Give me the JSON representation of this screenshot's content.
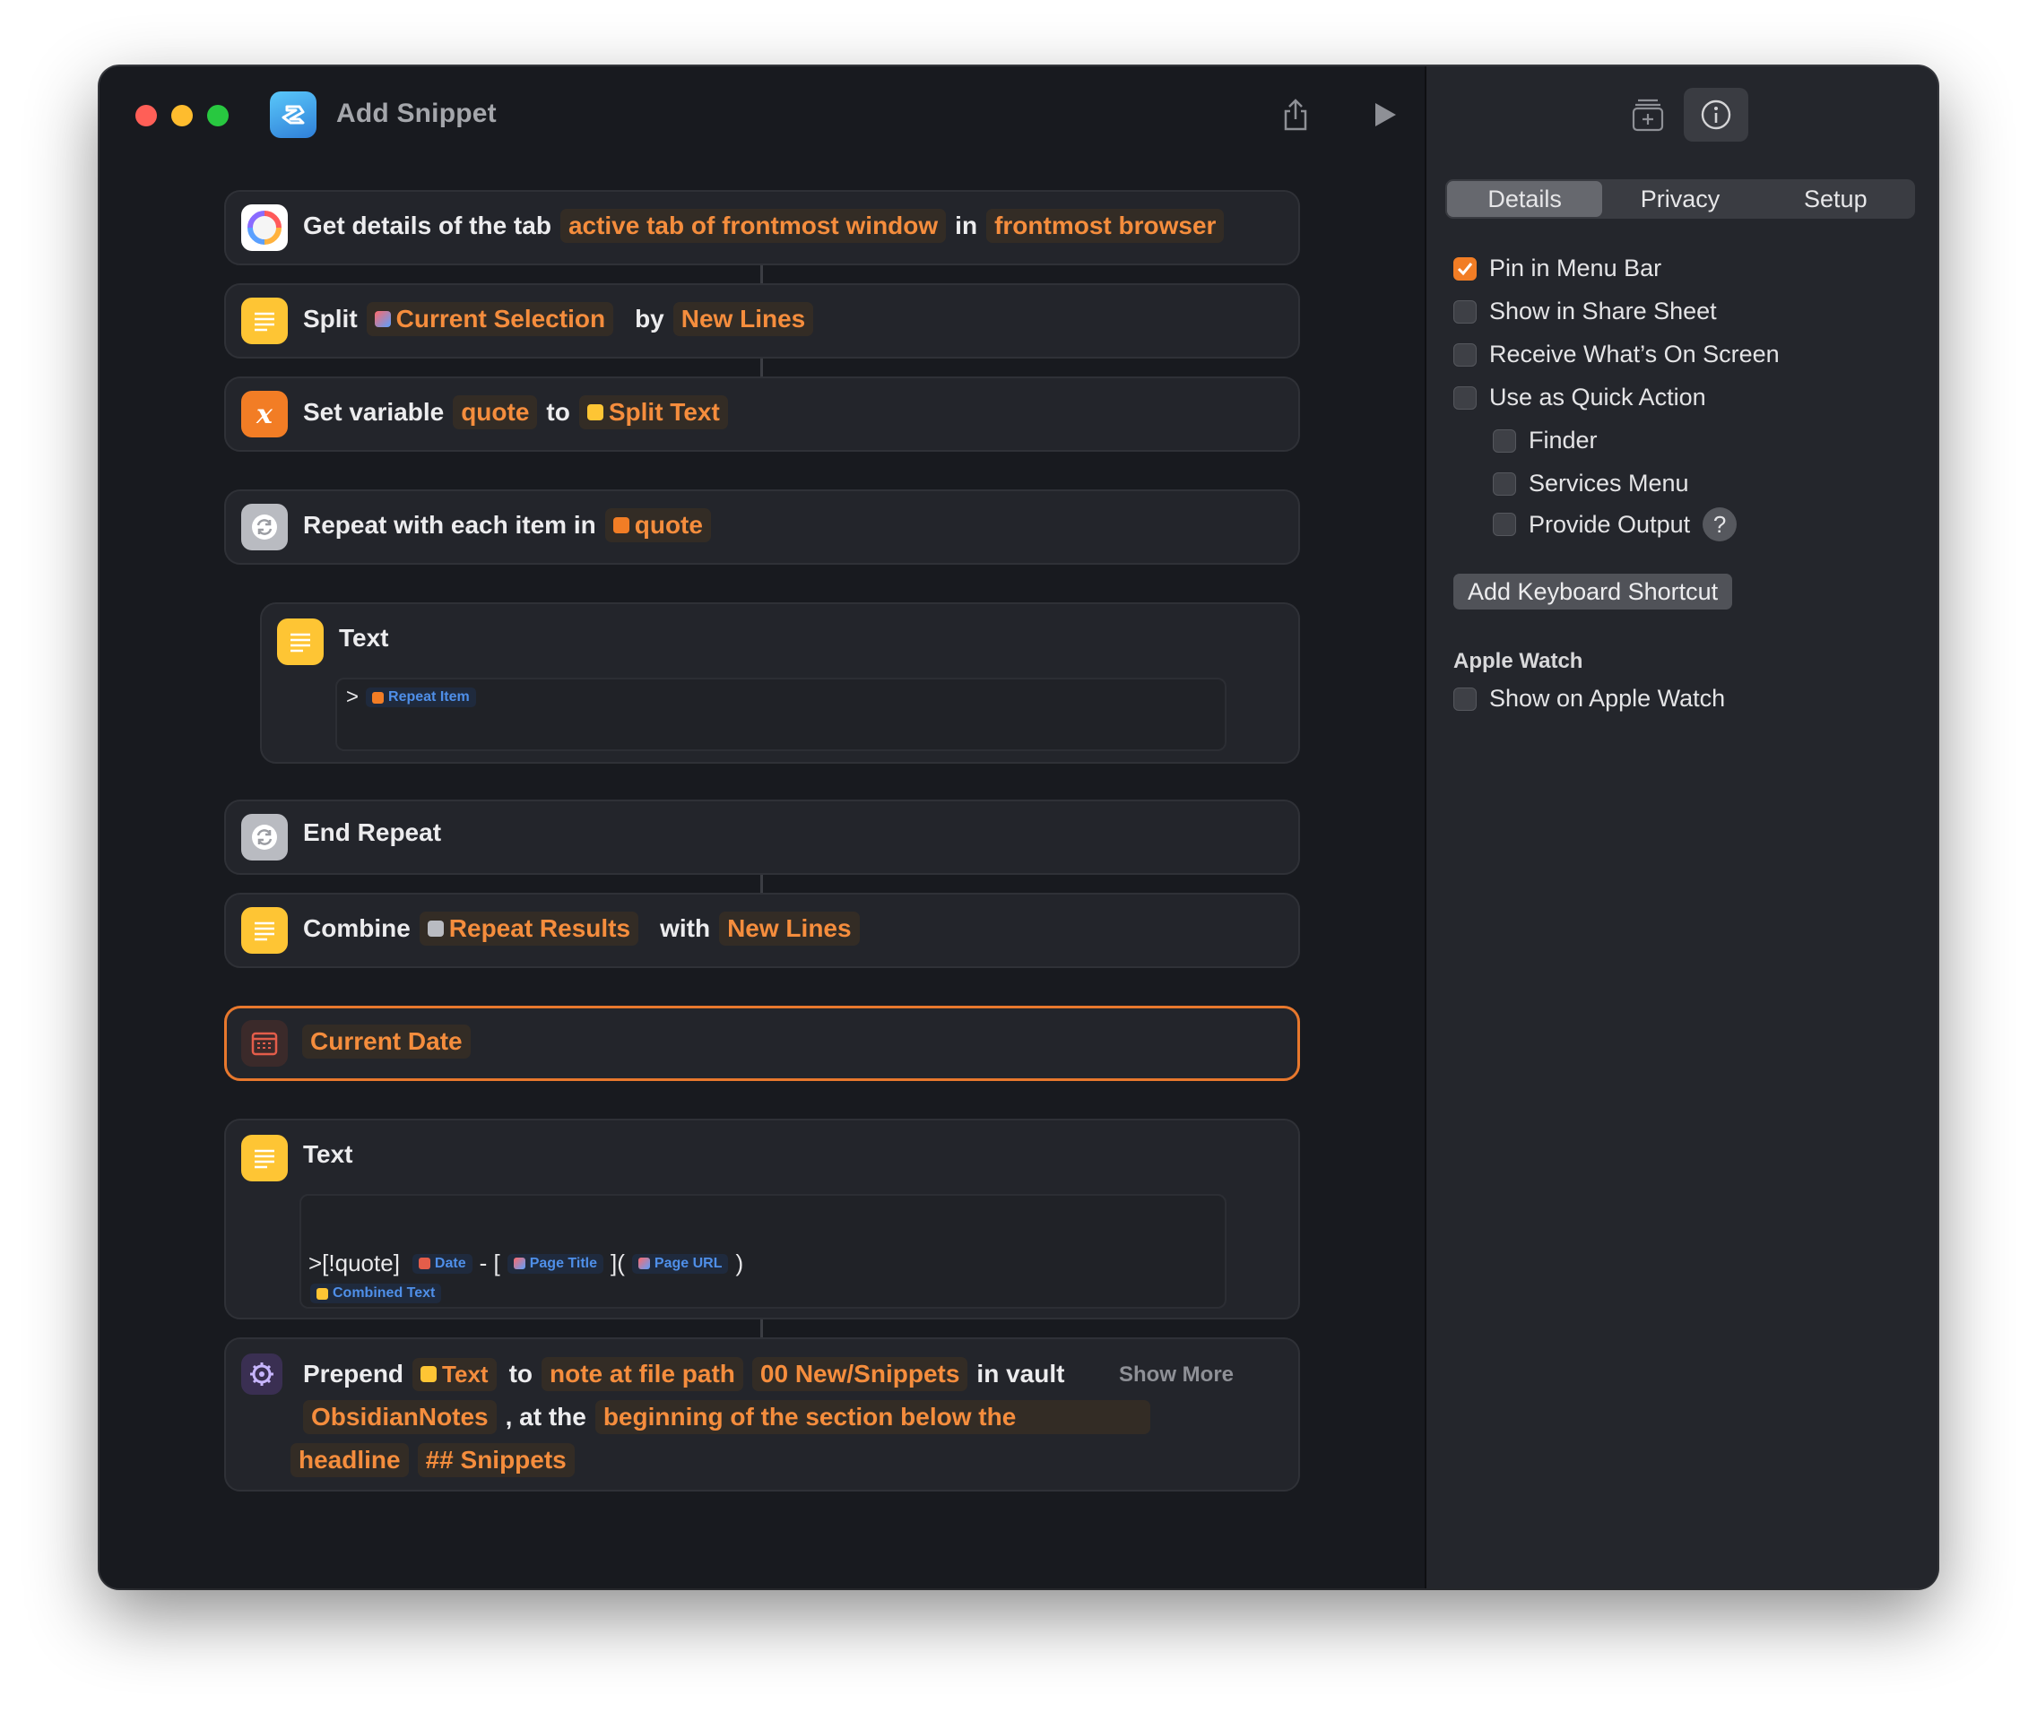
{
  "window": {
    "title": "Add Snippet"
  },
  "actions": {
    "get_details": {
      "label": "Get details of the tab",
      "param1": "active tab of frontmost window",
      "in": "in",
      "param2": "frontmost browser"
    },
    "split": {
      "label": "Split",
      "param1": "Current Selection",
      "by": "by",
      "param2": "New Lines"
    },
    "set_variable": {
      "label": "Set variable",
      "name": "quote",
      "to": "to",
      "value": "Split Text"
    },
    "repeat": {
      "label": "Repeat with each item in",
      "var": "quote"
    },
    "text1": {
      "label": "Text",
      "prefix": ">",
      "var": "Repeat Item"
    },
    "end_repeat": {
      "label": "End Repeat"
    },
    "combine": {
      "label": "Combine",
      "param1": "Repeat Results",
      "with": "with",
      "param2": "New Lines"
    },
    "current_date": {
      "label": "Current Date"
    },
    "text2": {
      "label": "Text",
      "part1": ">[!quote]",
      "var_date": "Date",
      "part2": "- [",
      "var_title": "Page Title",
      "part3": "](",
      "var_url": "Page URL",
      "part4": ")",
      "var_combined": "Combined Text"
    },
    "prepend": {
      "label": "Prepend",
      "var_text": "Text",
      "to": "to",
      "param1": "note at file path",
      "param2": "00 New/Snippets",
      "in_vault": "in vault",
      "show_more": "Show More",
      "param3": "ObsidianNotes",
      "at_the": ", at the",
      "param4": "beginning of the section below the",
      "param5": "headline",
      "param6": "## Snippets"
    }
  },
  "sidebar": {
    "tabs": [
      "Details",
      "Privacy",
      "Setup"
    ],
    "active_tab": "Details",
    "options": [
      {
        "label": "Pin in Menu Bar",
        "checked": true
      },
      {
        "label": "Show in Share Sheet",
        "checked": false
      },
      {
        "label": "Receive What’s On Screen",
        "checked": false
      },
      {
        "label": "Use as Quick Action",
        "checked": false
      },
      {
        "label": "Finder",
        "checked": false
      },
      {
        "label": "Services Menu",
        "checked": false
      },
      {
        "label": "Provide Output",
        "checked": false
      }
    ],
    "help": "?",
    "keyboard_button": "Add Keyboard Shortcut",
    "apple_watch_heading": "Apple Watch",
    "apple_watch_option": {
      "label": "Show on Apple Watch",
      "checked": false
    }
  },
  "colors": {
    "accent": "#F27D25",
    "window_bg": "#181A1F",
    "card_bg": "#23252B",
    "sidebar_bg": "#24262C"
  },
  "icons": [
    "share-icon",
    "play-icon",
    "add-to-library-icon",
    "info-icon"
  ]
}
